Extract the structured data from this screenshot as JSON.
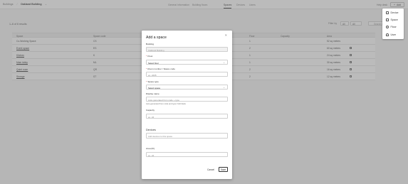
{
  "header": {
    "breadcrumb_root": "Buildings",
    "breadcrumb_sep": "/",
    "breadcrumb_current": "Oakland Building",
    "tabs": [
      "General Information",
      "Building floors",
      "Spaces",
      "Devices",
      "Users"
    ],
    "active_tab": "Spaces",
    "right_link": "Help desk",
    "add_label": "Add"
  },
  "page": {
    "count_text": "1–6 of 6 results",
    "filter_label": "Filter by",
    "filter_value": "All",
    "per_page_value": "All",
    "search_placeholder": "Search spaces"
  },
  "table": {
    "columns": [
      "Space",
      "Space code",
      "Floor",
      "Capacity",
      "Area"
    ],
    "rows": [
      {
        "space": "Co-Working Space",
        "code": "CS",
        "floor": "1",
        "capacity": "",
        "area": "52 sq meters",
        "link": false,
        "icon": false
      },
      {
        "space": "Event space",
        "code": "ES",
        "floor": "2",
        "capacity": "",
        "area": "60 sq meters",
        "link": true,
        "icon": true
      },
      {
        "space": "Kitchen",
        "code": "K",
        "floor": "1",
        "capacity": "",
        "area": "24 sq meters",
        "link": true,
        "icon": true
      },
      {
        "space": "Main lobby",
        "code": "ML",
        "floor": "1",
        "capacity": "",
        "area": "30 sq meters",
        "link": true,
        "icon": true
      },
      {
        "space": "Quiet room",
        "code": "QR",
        "floor": "2",
        "capacity": "",
        "area": "16 sq meters",
        "link": true,
        "icon": true
      },
      {
        "space": "Storage",
        "code": "ST",
        "floor": "2",
        "capacity": "",
        "area": "12 sq meters",
        "link": true,
        "icon": true
      }
    ]
  },
  "menu": {
    "items": [
      {
        "label": "Device",
        "icon": "device-icon"
      },
      {
        "label": "Space",
        "icon": "space-icon"
      },
      {
        "label": "Floor",
        "icon": "floor-icon"
      },
      {
        "label": "User",
        "icon": "user-icon"
      }
    ]
  },
  "modal": {
    "title": "Add a space",
    "close_glyph": "×",
    "building_label": "Building",
    "building_value": "Oakland Building",
    "floor_label": "Floor",
    "floor_value": "Select floor",
    "room_label": "Room number / Space code",
    "room_placeholder": "ex. 2205",
    "type_label": "Space type",
    "type_value": "Select space",
    "display_label": "Display name",
    "display_placeholder": "Auto-generated from code + type",
    "display_hint": "Auto-generated from code and type if left blank",
    "capacity_label": "Capacity",
    "capacity_placeholder": "ex. 24",
    "devices_section": "Devices",
    "devices_placeholder": "Add devices to this space",
    "area_label": "Area (ft²)",
    "area_placeholder": "ex. 24",
    "cancel_label": "Cancel",
    "save_label": "Save"
  },
  "colors": {
    "overlay": "#7a7a7a",
    "required": "#d13c3c",
    "primary_text": "#222222"
  }
}
